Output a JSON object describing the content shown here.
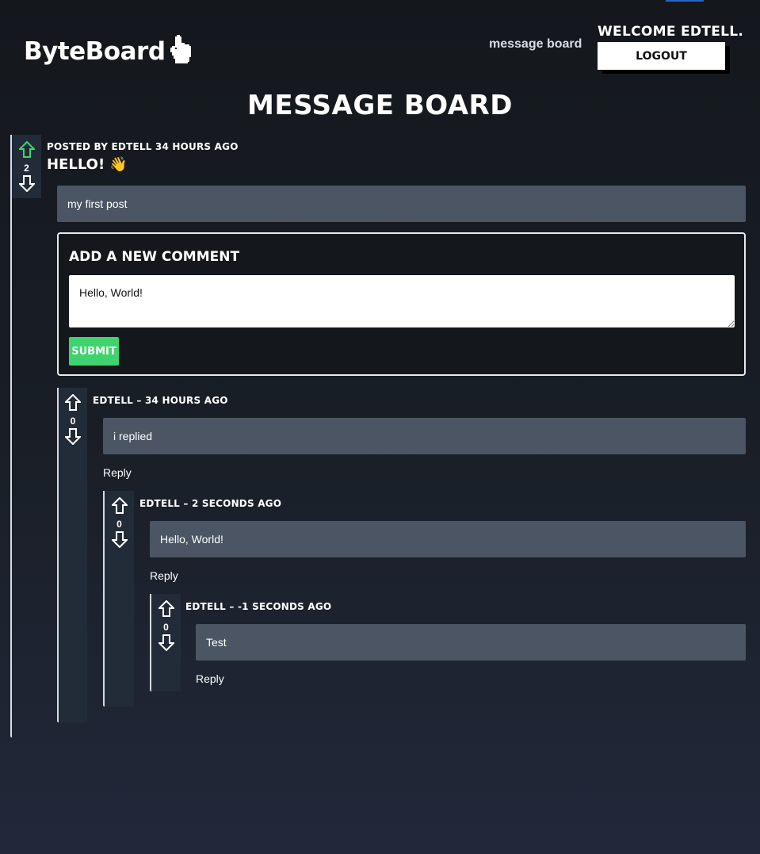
{
  "header": {
    "logo_text": "ByteBoard",
    "nav_link": "message board",
    "welcome": "Welcome edtell.",
    "logout_label": "Logout"
  },
  "page_title": "Message Board",
  "post": {
    "meta": "Posted by edtell 34 hours ago",
    "title": "Hello! 👋",
    "votes": "2",
    "body": "my first post"
  },
  "comment_form": {
    "title": "Add a new comment",
    "value": "Hello, World!",
    "submit_label": "Submit"
  },
  "comments": [
    {
      "meta": "edtell – 34 hours ago",
      "votes": "0",
      "body": "i replied",
      "reply_label": "Reply"
    },
    {
      "meta": "edtell – 2 seconds ago",
      "votes": "0",
      "body": "Hello, World!",
      "reply_label": "Reply"
    },
    {
      "meta": "edtell – -1 seconds ago",
      "votes": "0",
      "body": "Test",
      "reply_label": "Reply"
    }
  ],
  "colors": {
    "upvote_active": "#3fd36f",
    "vote_bg": "#222b38",
    "bubble_bg": "#4b5563",
    "submit": "#3fd36f"
  },
  "icons": {
    "logo": "pointer-hand-icon",
    "up": "arrow-up-icon",
    "down": "arrow-down-icon"
  }
}
